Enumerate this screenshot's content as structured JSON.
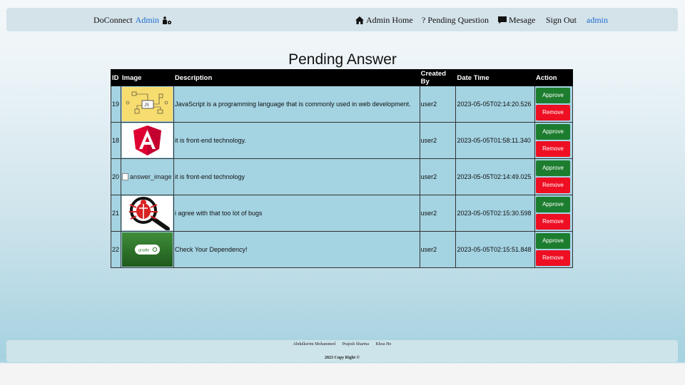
{
  "navbar": {
    "brand": "DoConnect",
    "brand_accent": "Admin",
    "items": [
      {
        "label": "Admin Home",
        "icon": "home-icon"
      },
      {
        "label": "? Pending Question",
        "icon": ""
      },
      {
        "label": "Mesage",
        "icon": "message-icon"
      },
      {
        "label": "Sign Out",
        "icon": ""
      },
      {
        "label": "admin",
        "icon": ""
      }
    ]
  },
  "page": {
    "title": "Pending Answer"
  },
  "table": {
    "columns": [
      "ID",
      "Image",
      "Description",
      "Created By",
      "Date Time",
      "Action"
    ],
    "approve_label": "Approve",
    "remove_label": "Remove",
    "rows": [
      {
        "id": "19",
        "image": "javascript-diagram",
        "description": "JavaScript is a programming language that is commonly used in web development.",
        "created_by": "user2",
        "date_time": "2023-05-05T02:14:20.526"
      },
      {
        "id": "18",
        "image": "angular-logo",
        "description": "it is front-end technology.",
        "created_by": "user2",
        "date_time": "2023-05-05T01:58:11.340"
      },
      {
        "id": "20",
        "image": "broken",
        "image_alt": "answer_image",
        "description": "it is front-end technology",
        "created_by": "user2",
        "date_time": "2023-05-05T02:14:49.025"
      },
      {
        "id": "21",
        "image": "bug-magnifier",
        "description": "i agree with that too lot of bugs",
        "created_by": "user2",
        "date_time": "2023-05-05T02:15:30.598"
      },
      {
        "id": "22",
        "image": "dependency-badge",
        "image_text": "gradle",
        "description": "Check Your Dependency!",
        "created_by": "user2",
        "date_time": "2023-05-05T02:15:51.848"
      }
    ]
  },
  "footer": {
    "names": [
      "Abdulkerim Mohammed",
      "Prajesh Sharma",
      "Khoa Ho"
    ],
    "copyright": "2023 Copy Right ©"
  },
  "colors": {
    "approve": "#1c7d2e",
    "remove": "#ee0f23",
    "link": "#1f6fd1",
    "row_bg": "#a4d3e2"
  }
}
